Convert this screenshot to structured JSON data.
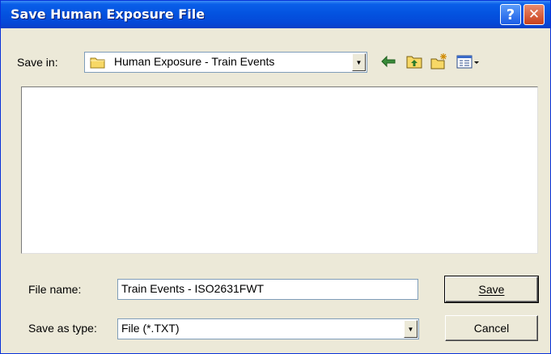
{
  "window": {
    "title": "Save Human Exposure File",
    "help_glyph": "?",
    "close_glyph": "✕"
  },
  "save_in": {
    "label": "Save in:",
    "value": "Human Exposure - Train Events"
  },
  "toolbar": {
    "icons": [
      "back-icon",
      "up-folder-icon",
      "new-folder-icon",
      "view-menu-icon"
    ]
  },
  "file_name": {
    "label": "File name:",
    "value": "Train Events - ISO2631FWT"
  },
  "save_as_type": {
    "label": "Save as type:",
    "value": "File (*.TXT)"
  },
  "buttons": {
    "save": "Save",
    "cancel": "Cancel"
  },
  "colors": {
    "titlebar": "#0453e0",
    "dialog_face": "#ece9d8",
    "close_button": "#c8401b"
  }
}
